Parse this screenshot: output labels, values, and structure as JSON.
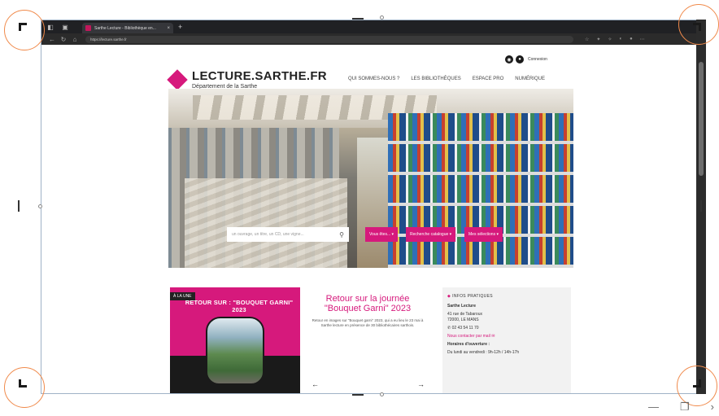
{
  "browser": {
    "tab_title": "Sarthe Lecture - Bibliothèque en...",
    "tab_close": "×",
    "new_tab": "+",
    "address": "https://lecture.sarthe.fr",
    "nav": {
      "back": "←",
      "forward": "→",
      "reload": "↻",
      "home": "⌂"
    }
  },
  "site": {
    "connexion": "Connexion",
    "logo_main": "LECTURE.SARTHE.FR",
    "logo_sub": "Département de la Sarthe",
    "nav": [
      "QUI SOMMES-NOUS ?",
      "LES BIBLIOTHÈQUES",
      "ESPACE PRO",
      "NUMÉRIQUE"
    ],
    "search_placeholder": "un ouvrage, un titre, un CD, une vigne...",
    "pills": [
      "Vous êtes... ▾",
      "Recherche catalogue ▾",
      "Mes sélections ▾"
    ]
  },
  "card_news": {
    "badge": "À LA UNE",
    "title": "RETOUR SUR : \"BOUQUET GARNI\" 2023"
  },
  "card_feature": {
    "title": "Retour sur la journée \"Bouquet Garni\" 2023",
    "text": "Retour en images sur \"Bouquet garni\" 2023, qui a eu lieu le 23 mai à Sarthe lecture en présence de 30 bibliothécaires sarthois.",
    "prev": "←",
    "next": "→"
  },
  "card_infos": {
    "heading": "INFOS PRATIQUES",
    "org": "Sarthe Lecture",
    "address1": "41 rue de Tabaroux",
    "address2": "72000, LE MANS",
    "phone": "02 43 54 11 70",
    "contact": "Nous contacter par mail ✉",
    "hours_label": "Horaires d'ouverture :",
    "hours": "Du lundi au vendredi : 9h-12h / 14h-17h"
  },
  "window": {
    "minimize": "—",
    "restore": "❐",
    "more": "›"
  }
}
